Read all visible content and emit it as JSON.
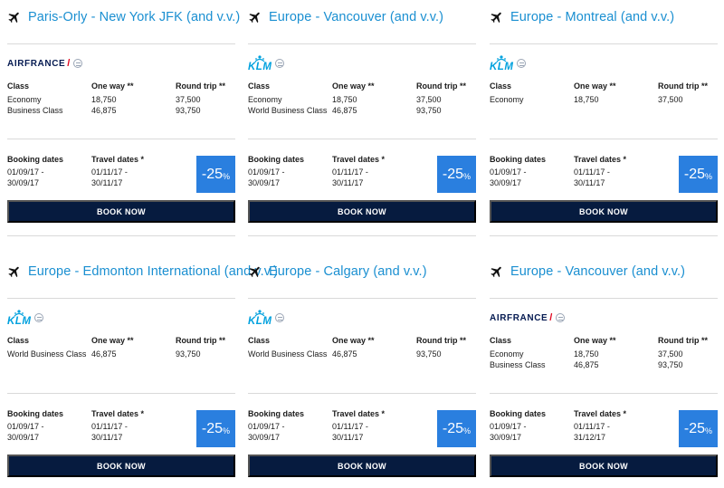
{
  "cards": [
    {
      "route": "Paris-Orly - New York JFK (and v.v.)",
      "airline": "airfrance",
      "logo_text": "AIRFRANCE",
      "headers": {
        "class": "Class",
        "one_way": "One way **",
        "round_trip": "Round trip **"
      },
      "fares": [
        {
          "class_name": "Economy",
          "one_way": "18,750",
          "round_trip": "37,500"
        },
        {
          "class_name": "Business Class",
          "one_way": "46,875",
          "round_trip": "93,750"
        }
      ],
      "booking_label": "Booking dates",
      "booking_from": "01/09/17 -",
      "booking_to": "30/09/17",
      "travel_label": "Travel dates *",
      "travel_from": "01/11/17 -",
      "travel_to": "30/11/17",
      "discount": "-25",
      "discount_unit": "%",
      "book_label": "BOOK NOW"
    },
    {
      "route": "Europe - Vancouver (and v.v.)",
      "airline": "klm",
      "logo_text": "KLM",
      "headers": {
        "class": "Class",
        "one_way": "One way **",
        "round_trip": "Round trip **"
      },
      "fares": [
        {
          "class_name": "Economy",
          "one_way": "18,750",
          "round_trip": "37,500"
        },
        {
          "class_name": "World Business Class",
          "one_way": "46,875",
          "round_trip": "93,750"
        }
      ],
      "booking_label": "Booking dates",
      "booking_from": "01/09/17 -",
      "booking_to": "30/09/17",
      "travel_label": "Travel dates *",
      "travel_from": "01/11/17 -",
      "travel_to": "30/11/17",
      "discount": "-25",
      "discount_unit": "%",
      "book_label": "BOOK NOW"
    },
    {
      "route": "Europe - Montreal (and v.v.)",
      "airline": "klm",
      "logo_text": "KLM",
      "headers": {
        "class": "Class",
        "one_way": "One way **",
        "round_trip": "Round trip **"
      },
      "fares": [
        {
          "class_name": "Economy",
          "one_way": "18,750",
          "round_trip": "37,500"
        }
      ],
      "booking_label": "Booking dates",
      "booking_from": "01/09/17 -",
      "booking_to": "30/09/17",
      "travel_label": "Travel dates *",
      "travel_from": "01/11/17 -",
      "travel_to": "30/11/17",
      "discount": "-25",
      "discount_unit": "%",
      "book_label": "BOOK NOW"
    },
    {
      "route": "Europe - Edmonton International (and v.v.)",
      "airline": "klm",
      "logo_text": "KLM",
      "headers": {
        "class": "Class",
        "one_way": "One way **",
        "round_trip": "Round trip **"
      },
      "fares": [
        {
          "class_name": "World Business Class",
          "one_way": "46,875",
          "round_trip": "93,750"
        }
      ],
      "booking_label": "Booking dates",
      "booking_from": "01/09/17 -",
      "booking_to": "30/09/17",
      "travel_label": "Travel dates *",
      "travel_from": "01/11/17 -",
      "travel_to": "30/11/17",
      "discount": "-25",
      "discount_unit": "%",
      "book_label": "BOOK NOW"
    },
    {
      "route": "Europe - Calgary (and v.v.)",
      "airline": "klm",
      "logo_text": "KLM",
      "headers": {
        "class": "Class",
        "one_way": "One way **",
        "round_trip": "Round trip **"
      },
      "fares": [
        {
          "class_name": "World Business Class",
          "one_way": "46,875",
          "round_trip": "93,750"
        }
      ],
      "booking_label": "Booking dates",
      "booking_from": "01/09/17 -",
      "booking_to": "30/09/17",
      "travel_label": "Travel dates *",
      "travel_from": "01/11/17 -",
      "travel_to": "30/11/17",
      "discount": "-25",
      "discount_unit": "%",
      "book_label": "BOOK NOW"
    },
    {
      "route": "Europe - Vancouver (and v.v.)",
      "airline": "airfrance",
      "logo_text": "AIRFRANCE",
      "headers": {
        "class": "Class",
        "one_way": "One way **",
        "round_trip": "Round trip **"
      },
      "fares": [
        {
          "class_name": "Economy",
          "one_way": "18,750",
          "round_trip": "37,500"
        },
        {
          "class_name": "Business Class",
          "one_way": "46,875",
          "round_trip": "93,750"
        }
      ],
      "booking_label": "Booking dates",
      "booking_from": "01/09/17 -",
      "booking_to": "30/09/17",
      "travel_label": "Travel dates *",
      "travel_from": "01/11/17 -",
      "travel_to": "31/12/17",
      "discount": "-25",
      "discount_unit": "%",
      "book_label": "BOOK NOW"
    }
  ],
  "colors": {
    "route_link": "#1a8fd1",
    "book_button": "#061b3f",
    "discount_badge": "#2a7fdf",
    "airfrance_navy": "#061b52",
    "klm_blue": "#00a1de"
  },
  "icons": {
    "route": "airplane-icon",
    "alliance": "skyteam-icon"
  }
}
